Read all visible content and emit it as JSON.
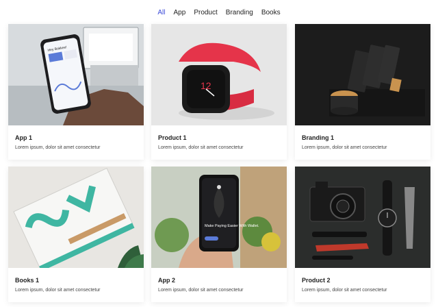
{
  "filters": [
    {
      "label": "All",
      "active": true
    },
    {
      "label": "App",
      "active": false
    },
    {
      "label": "Product",
      "active": false
    },
    {
      "label": "Branding",
      "active": false
    },
    {
      "label": "Books",
      "active": false
    }
  ],
  "cards": [
    {
      "title": "App 1",
      "desc": "Lorem ipsum, dolor sit amet consectetur"
    },
    {
      "title": "Product 1",
      "desc": "Lorem ipsum, dolor sit amet consectetur"
    },
    {
      "title": "Branding 1",
      "desc": "Lorem ipsum, dolor sit amet consectetur"
    },
    {
      "title": "Books 1",
      "desc": "Lorem ipsum, dolor sit amet consectetur"
    },
    {
      "title": "App 2",
      "desc": "Lorem ipsum, dolor sit amet consectetur"
    },
    {
      "title": "Product 2",
      "desc": "Lorem ipsum, dolor sit amet consectetur"
    }
  ],
  "images": {
    "app1_phone_text": "Hey Bokkee!",
    "watch_face": "12",
    "app2_phone_text": "Make Paying Easier With Wallet."
  },
  "colors": {
    "accent": "#3a49d8",
    "watch_band": "#e5344a"
  }
}
